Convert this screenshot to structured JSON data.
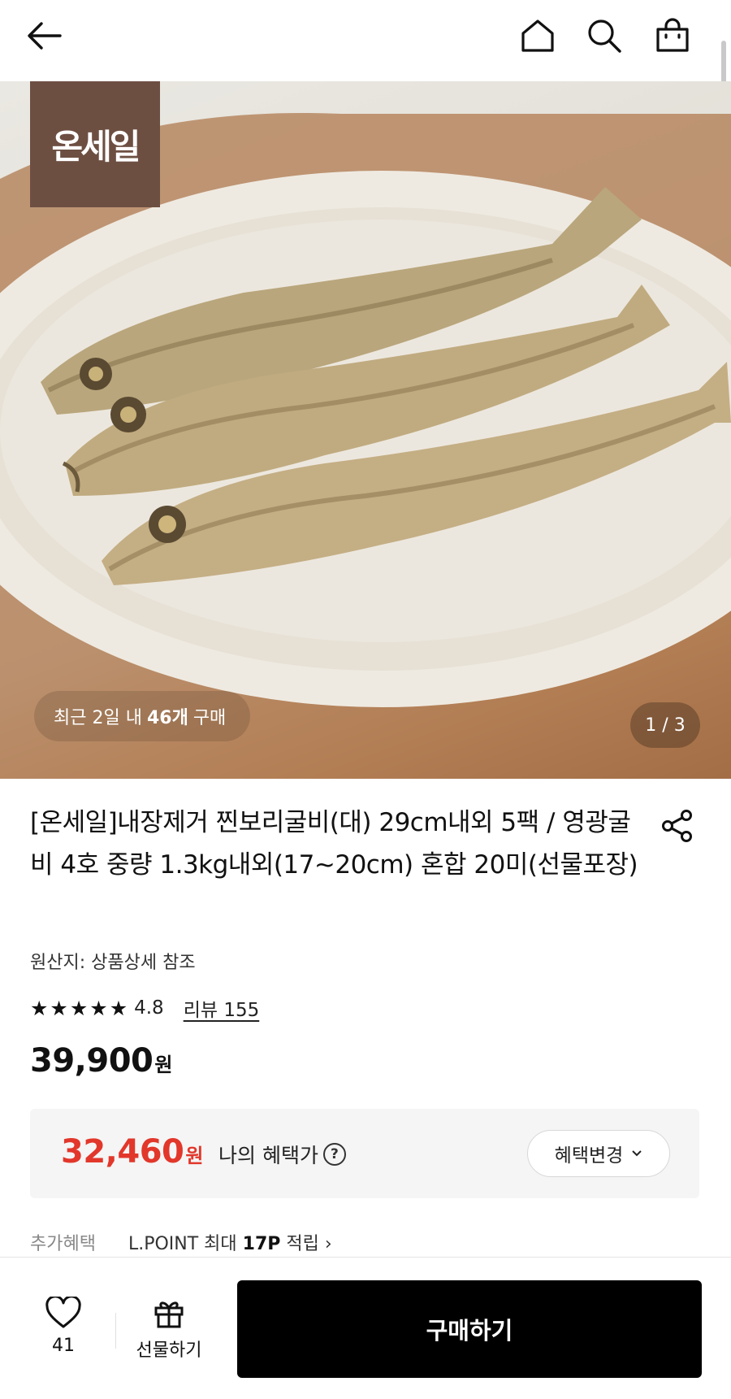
{
  "header": {
    "back_icon": "arrow-left-icon",
    "home_icon": "home-icon",
    "search_icon": "search-icon",
    "cart_icon": "shopping-bag-icon"
  },
  "hero": {
    "brand_logo_text": "온세일",
    "purchase_prefix": "최근 2일 내",
    "purchase_count": "46개",
    "purchase_suffix": "구매",
    "pager": "1 / 3"
  },
  "product": {
    "title": "[온세일]내장제거 찐보리굴비(대) 29cm내외 5팩 / 영광굴비 4호 중량 1.3kg내외(17~20cm) 혼합 20미(선물포장)",
    "origin": "원산지: 상품상세 참조",
    "rating_stars": 5,
    "rating": "4.8",
    "review_link": "리뷰 155",
    "price_value": "39,900",
    "price_unit": "원"
  },
  "benefit": {
    "price_value": "32,460",
    "price_unit": "원",
    "label": "나의 혜택가",
    "help_icon": "question-circle-icon",
    "change_button": "혜택변경"
  },
  "extra": {
    "label": "추가혜택",
    "point_text": "L.POINT 최대",
    "point_amount": "17P",
    "point_suffix": "적립 ›"
  },
  "bottom_bar": {
    "like_count": "41",
    "gift_label": "선물하기",
    "buy_label": "구매하기"
  },
  "colors": {
    "accent_price": "#e2372b",
    "brand_logo_bg": "#6d4f42",
    "buy_button": "#000000"
  }
}
